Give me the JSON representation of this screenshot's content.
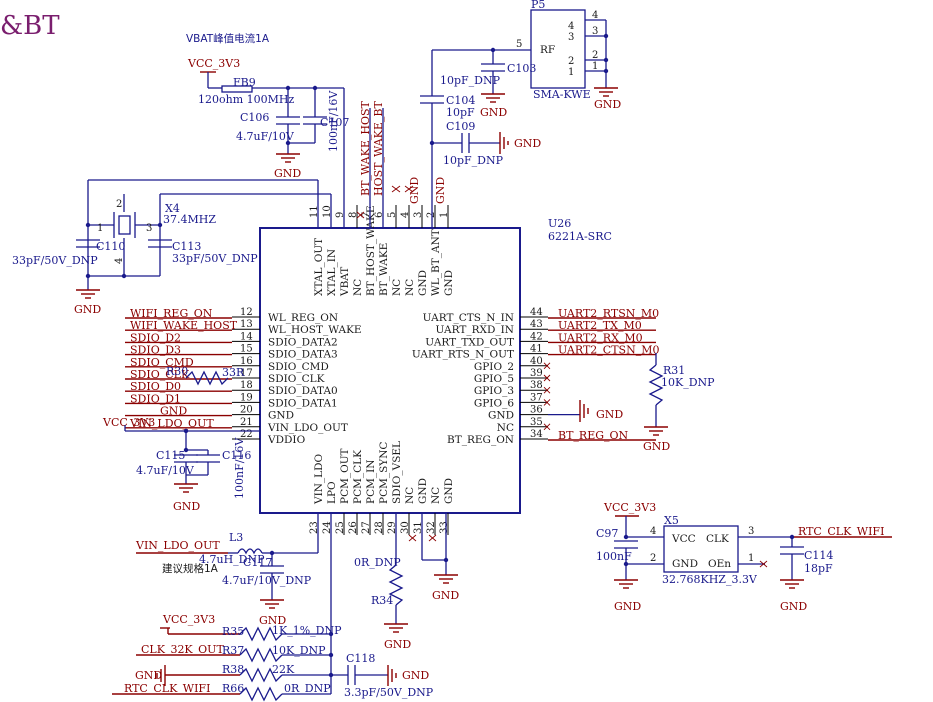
{
  "title": "&BT",
  "u26": {
    "ref": "U26",
    "part": "6221A-SRC"
  },
  "top_pins": [
    {
      "num": "11",
      "name": "XTAL_OUT"
    },
    {
      "num": "10",
      "name": "XTAL_IN"
    },
    {
      "num": "9",
      "name": "VBAT"
    },
    {
      "num": "8",
      "name": "NC"
    },
    {
      "num": "7",
      "name": "BT_HOST_WAKE"
    },
    {
      "num": "6",
      "name": "BT_WAKE"
    },
    {
      "num": "5",
      "name": "NC"
    },
    {
      "num": "4",
      "name": "NC"
    },
    {
      "num": "3",
      "name": "GND"
    },
    {
      "num": "2",
      "name": "WL_BT_ANT"
    },
    {
      "num": "1",
      "name": "GND"
    }
  ],
  "left_pins": [
    {
      "num": "12",
      "name": "WL_REG_ON",
      "net": "WIFI_REG_ON"
    },
    {
      "num": "13",
      "name": "WL_HOST_WAKE",
      "net": "WIFI_WAKE_HOST"
    },
    {
      "num": "14",
      "name": "SDIO_DATA2",
      "net": "SDIO_D2"
    },
    {
      "num": "15",
      "name": "SDIO_DATA3",
      "net": "SDIO_D3"
    },
    {
      "num": "16",
      "name": "SDIO_CMD",
      "net": "SDIO_CMD"
    },
    {
      "num": "17",
      "name": "SDIO_CLK",
      "net": "SDIO_CLK"
    },
    {
      "num": "18",
      "name": "SDIO_DATA0",
      "net": "SDIO_D0"
    },
    {
      "num": "19",
      "name": "SDIO_DATA1",
      "net": "SDIO_D1"
    },
    {
      "num": "20",
      "name": "GND",
      "net": "GND"
    },
    {
      "num": "21",
      "name": "VIN_LDO_OUT",
      "net": "VIN_LDO_OUT"
    },
    {
      "num": "22",
      "name": "VDDIO",
      "net": ""
    }
  ],
  "right_pins": [
    {
      "num": "44",
      "name": "UART_CTS_N_IN",
      "net": "UART2_RTSN_M0"
    },
    {
      "num": "43",
      "name": "UART_RXD_IN",
      "net": "UART2_TX_M0"
    },
    {
      "num": "42",
      "name": "UART_TXD_OUT",
      "net": "UART2_RX_M0"
    },
    {
      "num": "41",
      "name": "UART_RTS_N_OUT",
      "net": "UART2_CTSN_M0"
    },
    {
      "num": "40",
      "name": "GPIO_2",
      "net": ""
    },
    {
      "num": "39",
      "name": "GPIO_5",
      "net": ""
    },
    {
      "num": "38",
      "name": "GPIO_3",
      "net": ""
    },
    {
      "num": "37",
      "name": "GPIO_6",
      "net": ""
    },
    {
      "num": "36",
      "name": "GND",
      "net": "GND"
    },
    {
      "num": "35",
      "name": "NC",
      "net": ""
    },
    {
      "num": "34",
      "name": "BT_REG_ON",
      "net": "BT_REG_ON"
    }
  ],
  "bottom_pins": [
    {
      "num": "23",
      "name": "VIN_LDO"
    },
    {
      "num": "24",
      "name": "LPO"
    },
    {
      "num": "25",
      "name": "PCM_OUT"
    },
    {
      "num": "26",
      "name": "PCM_CLK"
    },
    {
      "num": "27",
      "name": "PCM_IN"
    },
    {
      "num": "28",
      "name": "PCM_SYNC"
    },
    {
      "num": "29",
      "name": "SDIO_VSEL"
    },
    {
      "num": "30",
      "name": "NC"
    },
    {
      "num": "31",
      "name": "GND"
    },
    {
      "num": "32",
      "name": "NC"
    },
    {
      "num": "33",
      "name": "GND"
    }
  ],
  "top_nets": {
    "host_wake": "BT_WAKE_HOST",
    "wake_bt": "HOST_WAKE_BT",
    "gnd": "GND"
  },
  "vbat": {
    "note": "VBAT峰值电流1A",
    "rail": "VCC_3V3",
    "fb_ref": "FB9",
    "fb_val": "120ohm 100MHz",
    "c1_ref": "C106",
    "c1_val": "4.7uF/10V",
    "c2_ref": "C107",
    "c2_val": "100nF/16V",
    "gnd": "GND"
  },
  "xtal": {
    "ref": "X4",
    "val": "37.4MHZ",
    "p1": "1",
    "p2": "2",
    "p3": "3",
    "p4": "4",
    "c1_ref": "C110",
    "c1_val": "33pF/50V_DNP",
    "c2_ref": "C113",
    "c2_val": "33pF/50V_DNP",
    "gnd": "GND"
  },
  "rf": {
    "p5_ref": "P5",
    "p5_part": "SMA-KWE",
    "rf_lbl": "RF",
    "pins_in": [
      "4",
      "3",
      "2",
      "1",
      "5"
    ],
    "pins_out": [
      "4",
      "3",
      "2",
      "1"
    ],
    "c103_ref": "C103",
    "c103_val": "10pF_DNP",
    "c104_ref": "C104",
    "c104_val": "10pF",
    "c109_ref": "C109",
    "c109_val": "10pF_DNP",
    "gnd": "GND"
  },
  "sdio": {
    "r30_ref": "R30",
    "r30_val": "33R"
  },
  "vddio": {
    "rail": "VCC_3V3",
    "c115_ref": "C115",
    "c115_val": "4.7uF/10V",
    "c116_ref": "C116",
    "c116_val": "100nF/16V",
    "gnd": "GND"
  },
  "r31": {
    "ref": "R31",
    "val": "10K_DNP",
    "gnd": "GND",
    "gnd2": "GND"
  },
  "ldo": {
    "net": "VIN_LDO_OUT",
    "l_ref": "L3",
    "l_val": "4.7uH_DNP",
    "c_ref": "C117",
    "c_val": "4.7uF/10V_DNP",
    "note": "建议规格1A",
    "gnd": "GND"
  },
  "bottom": {
    "r34_ref": "R34",
    "r34_val": "0R_DNP",
    "gnd": "GND",
    "gnd2": "GND",
    "gnd3": "GND"
  },
  "lpo": {
    "rail": "VCC_3V3",
    "r35_ref": "R35",
    "r35_val": "1K_1%_DNP",
    "clk_net": "CLK_32K_OUT",
    "r37_ref": "R37",
    "r37_val": "10K_DNP",
    "gnd_l": "GND",
    "r38_ref": "R38",
    "r38_val": "22K",
    "c118_ref": "C118",
    "c118_val": "3.3pF/50V_DNP",
    "gnd_r": "GND",
    "rtc_net": "RTC_CLK_WIFI",
    "r66_ref": "R66",
    "r66_val": "0R_DNP"
  },
  "x5": {
    "ref": "X5",
    "part": "32.768KHZ_3.3V",
    "rail": "VCC_3V3",
    "c97_ref": "C97",
    "c97_val": "100nF",
    "vcc": "VCC",
    "clk": "CLK",
    "gnd_pin": "GND",
    "oen": "OEn",
    "p4": "4",
    "p3": "3",
    "p2": "2",
    "p1": "1",
    "net": "RTC_CLK_WIFI",
    "c114_ref": "C114",
    "c114_val": "18pF",
    "gnd": "GND",
    "gnd2": "GND"
  }
}
